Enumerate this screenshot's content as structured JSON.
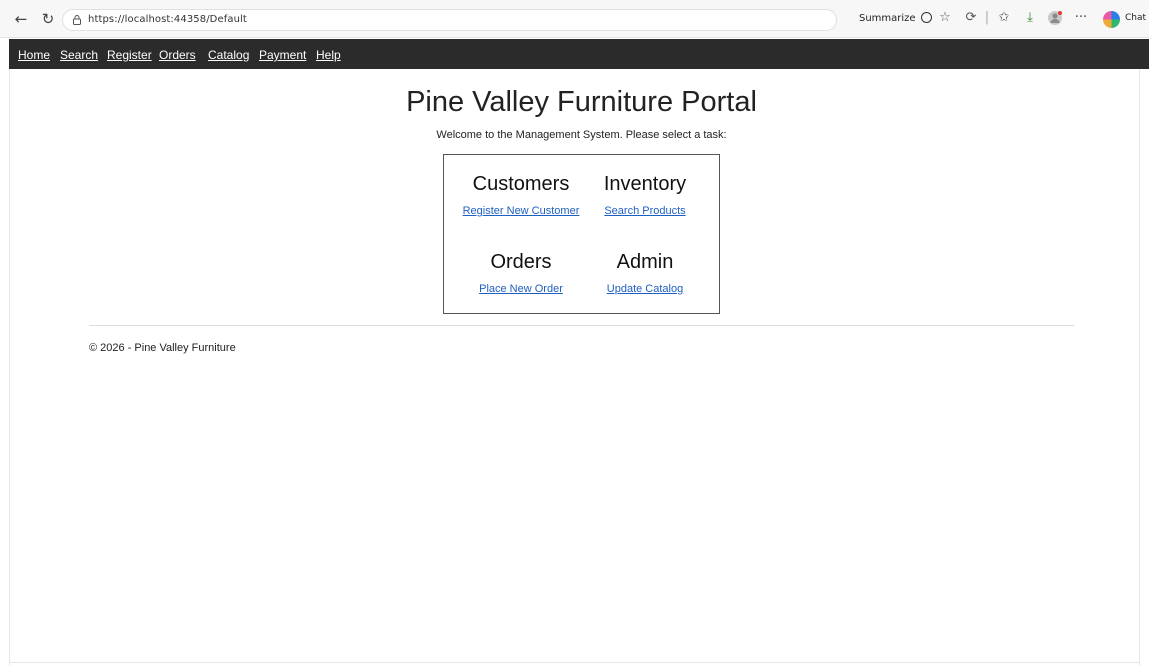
{
  "browser": {
    "url": "https://localhost:44358/Default",
    "summarize_label": "Summarize",
    "chat_label": "Chat",
    "more_label": "···",
    "separator": "|"
  },
  "site_nav": {
    "items": [
      "Home",
      "Search",
      "Register",
      "Orders",
      "Catalog",
      "Payment",
      "Help"
    ]
  },
  "main": {
    "title": "Pine Valley Furniture Portal",
    "welcome": "Welcome to the Management System. Please select a task:",
    "tasks": [
      {
        "heading": "Customers",
        "link": "Register New Customer"
      },
      {
        "heading": "Inventory",
        "link": "Search Products"
      },
      {
        "heading": "Orders",
        "link": "Place New Order"
      },
      {
        "heading": "Admin",
        "link": "Update Catalog"
      }
    ]
  },
  "footer": {
    "text": "© 2026 - Pine Valley Furniture"
  },
  "colors": {
    "nav_background": "#2b2b2b",
    "link": "#1e5fc2"
  }
}
